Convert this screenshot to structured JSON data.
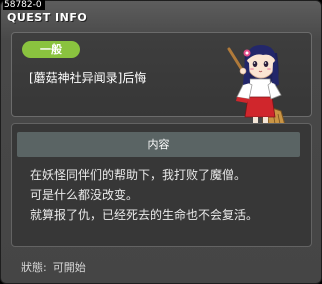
{
  "window": {
    "id_label": "58782-0",
    "title": "QUEST INFO"
  },
  "quest": {
    "category": "一般",
    "title": "[蘑菇神社异闻录]后悔",
    "npc_icon": "shrine-maiden-npc-icon"
  },
  "content": {
    "header": "内容",
    "lines": [
      "在妖怪同伴们的帮助下，我打败了魔僧。",
      "可是什么都没改变。",
      "就算报了仇，已经死去的生命也不会复活。"
    ]
  },
  "status": {
    "label": "狀態:",
    "value": "可開始"
  },
  "colors": {
    "category_badge": "#8ac33f",
    "content_header": "#5a6464",
    "panel_bg": "#373737"
  }
}
